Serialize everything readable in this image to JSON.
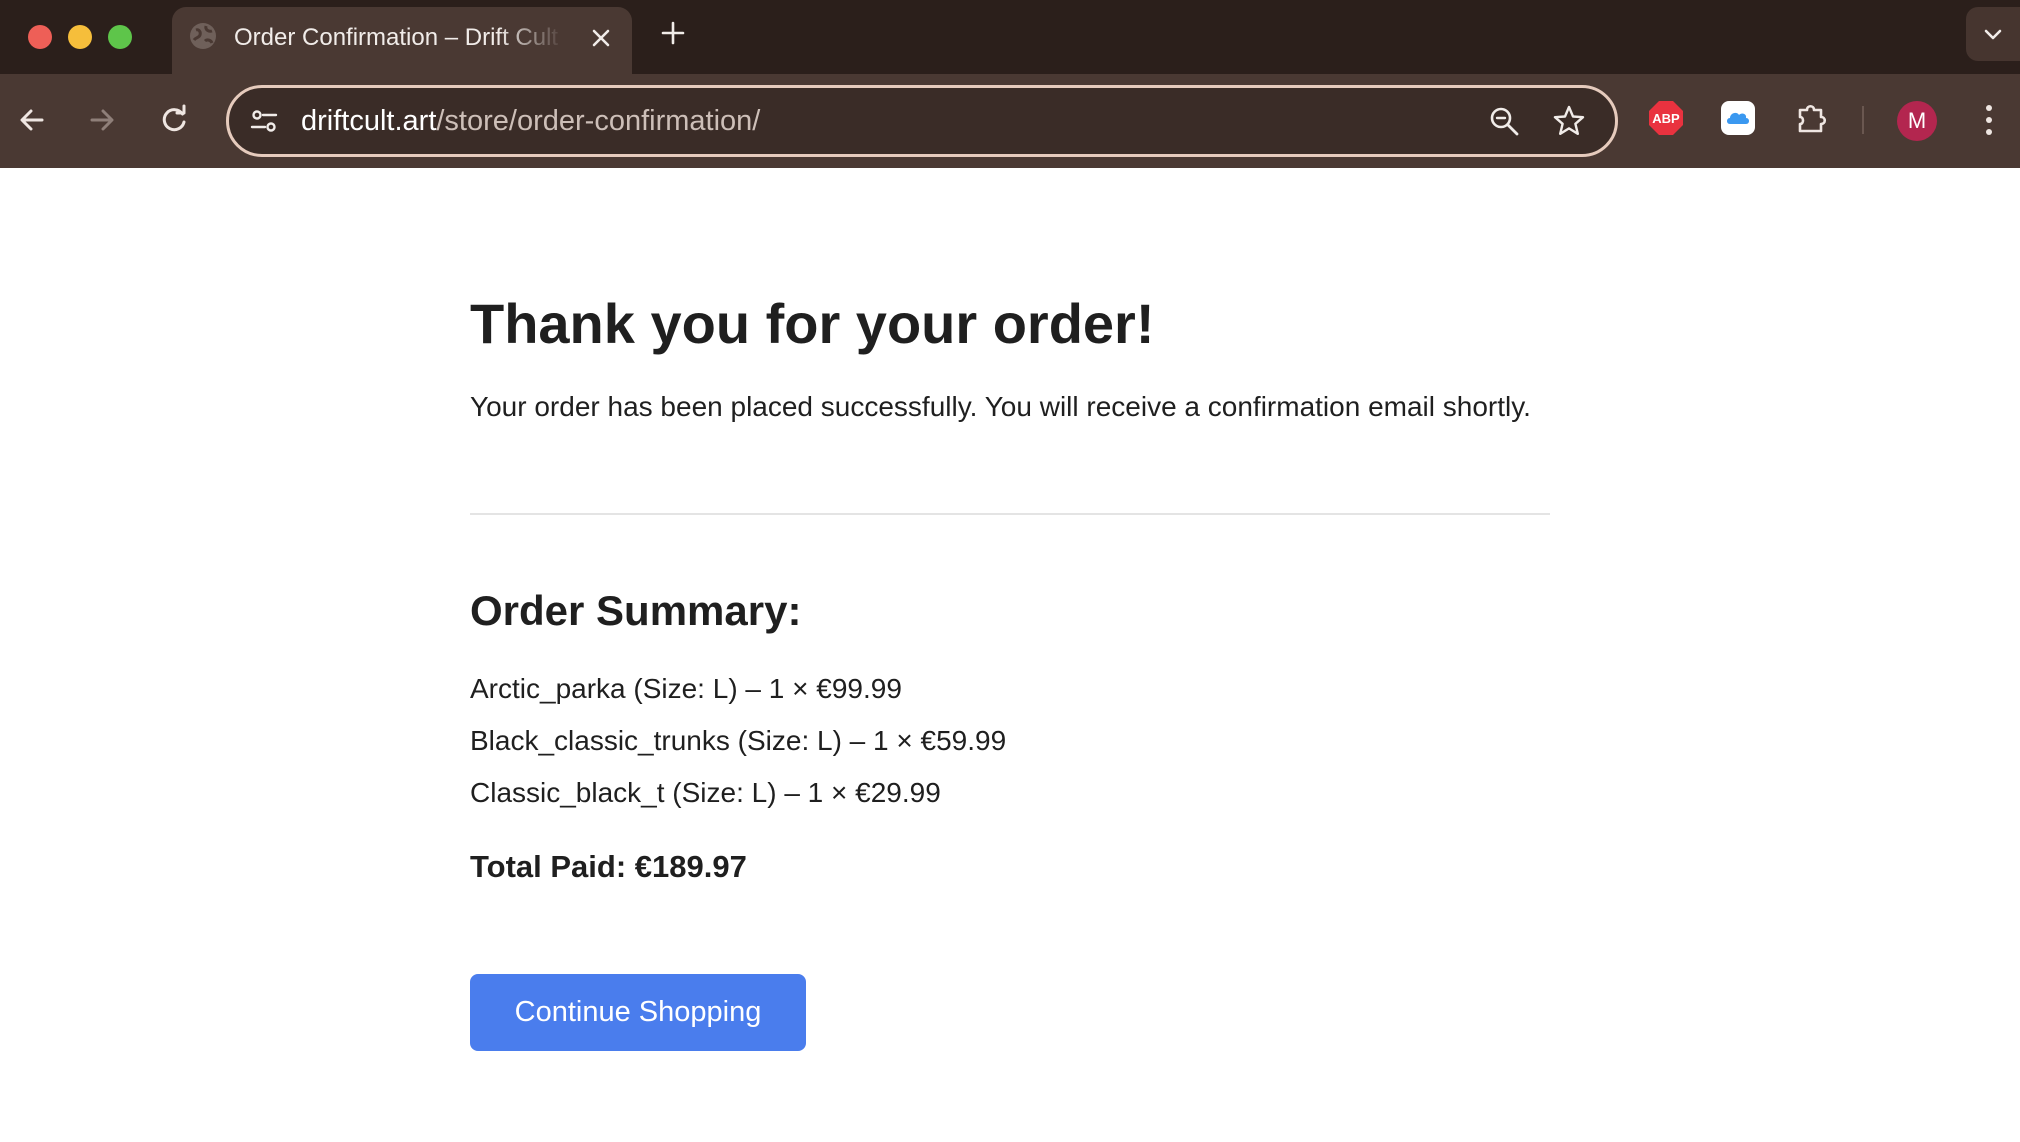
{
  "browser": {
    "tab": {
      "title": "Order Confirmation – Drift Cult Store"
    },
    "address_bar": {
      "host": "driftcult.art",
      "path": "/store/order-confirmation/"
    },
    "profile": {
      "initial": "M",
      "color": "#b3264f"
    },
    "extensions": [
      "adblock-plus-icon",
      "icloud-icon",
      "puzzle-extensions-icon"
    ],
    "extension_labels": {
      "adblock": "ABP"
    }
  },
  "page": {
    "heading": "Thank you for your order!",
    "message": "Your order has been placed successfully. You will receive a confirmation email shortly.",
    "summary_title": "Order Summary:",
    "items": [
      "Arctic_parka (Size: L) – 1 × €99.99",
      "Black_classic_trunks (Size: L) – 1 × €59.99",
      "Classic_black_t (Size: L) – 1 × €29.99"
    ],
    "total": "Total Paid: €189.97",
    "continue_button": "Continue Shopping",
    "accent_color": "#4a7ded"
  }
}
